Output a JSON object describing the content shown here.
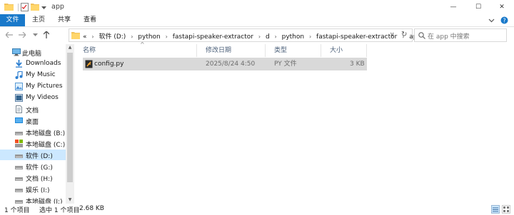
{
  "window": {
    "title": "app",
    "controls": {
      "minimize": "—",
      "maximize": "☐",
      "close": "✕"
    }
  },
  "ribbon": {
    "tabs": [
      "文件",
      "主页",
      "共享",
      "查看"
    ],
    "expand_icon": "chevron-down-icon",
    "help_icon": "help-icon"
  },
  "address": {
    "overflow": "«",
    "crumbs": [
      "软件 (D:)",
      "python",
      "fastapi-speaker-extractor",
      "d",
      "python",
      "fastapi-speaker-extractor",
      "app"
    ],
    "dropdown_glyph": "∨",
    "refresh_glyph": "↻"
  },
  "search": {
    "placeholder": "在 app 中搜索"
  },
  "nav": {
    "items": [
      {
        "label": "此电脑",
        "icon": "computer-icon"
      },
      {
        "label": "Downloads",
        "icon": "download-icon"
      },
      {
        "label": "My Music",
        "icon": "music-icon"
      },
      {
        "label": "My Pictures",
        "icon": "pictures-icon"
      },
      {
        "label": "My Videos",
        "icon": "videos-icon"
      },
      {
        "label": "文档",
        "icon": "documents-icon"
      },
      {
        "label": "桌面",
        "icon": "desktop-icon"
      },
      {
        "label": "本地磁盘 (B:)",
        "icon": "drive-icon"
      },
      {
        "label": "本地磁盘 (C:)",
        "icon": "drive-icon"
      },
      {
        "label": "软件 (D:)",
        "icon": "drive-icon",
        "selected": true
      },
      {
        "label": "软件 (G:)",
        "icon": "drive-icon"
      },
      {
        "label": "文档 (H:)",
        "icon": "drive-icon"
      },
      {
        "label": "娱乐 (I:)",
        "icon": "drive-icon"
      },
      {
        "label": "本地磁盘 (J:)",
        "icon": "drive-icon"
      }
    ]
  },
  "list": {
    "columns": {
      "name": "名称",
      "date": "修改日期",
      "type": "类型",
      "size": "大小"
    },
    "files": [
      {
        "name": "config.py",
        "date": "2025/8/24 4:50",
        "type": "PY 文件",
        "size": "3 KB"
      }
    ]
  },
  "status": {
    "count": "1 个项目",
    "selection": "选中 1 个项目",
    "size": "2.68 KB"
  },
  "colors": {
    "accent": "#1979ca",
    "selected_row": "#d9d9d9",
    "nav_selected": "#cce8ff"
  }
}
